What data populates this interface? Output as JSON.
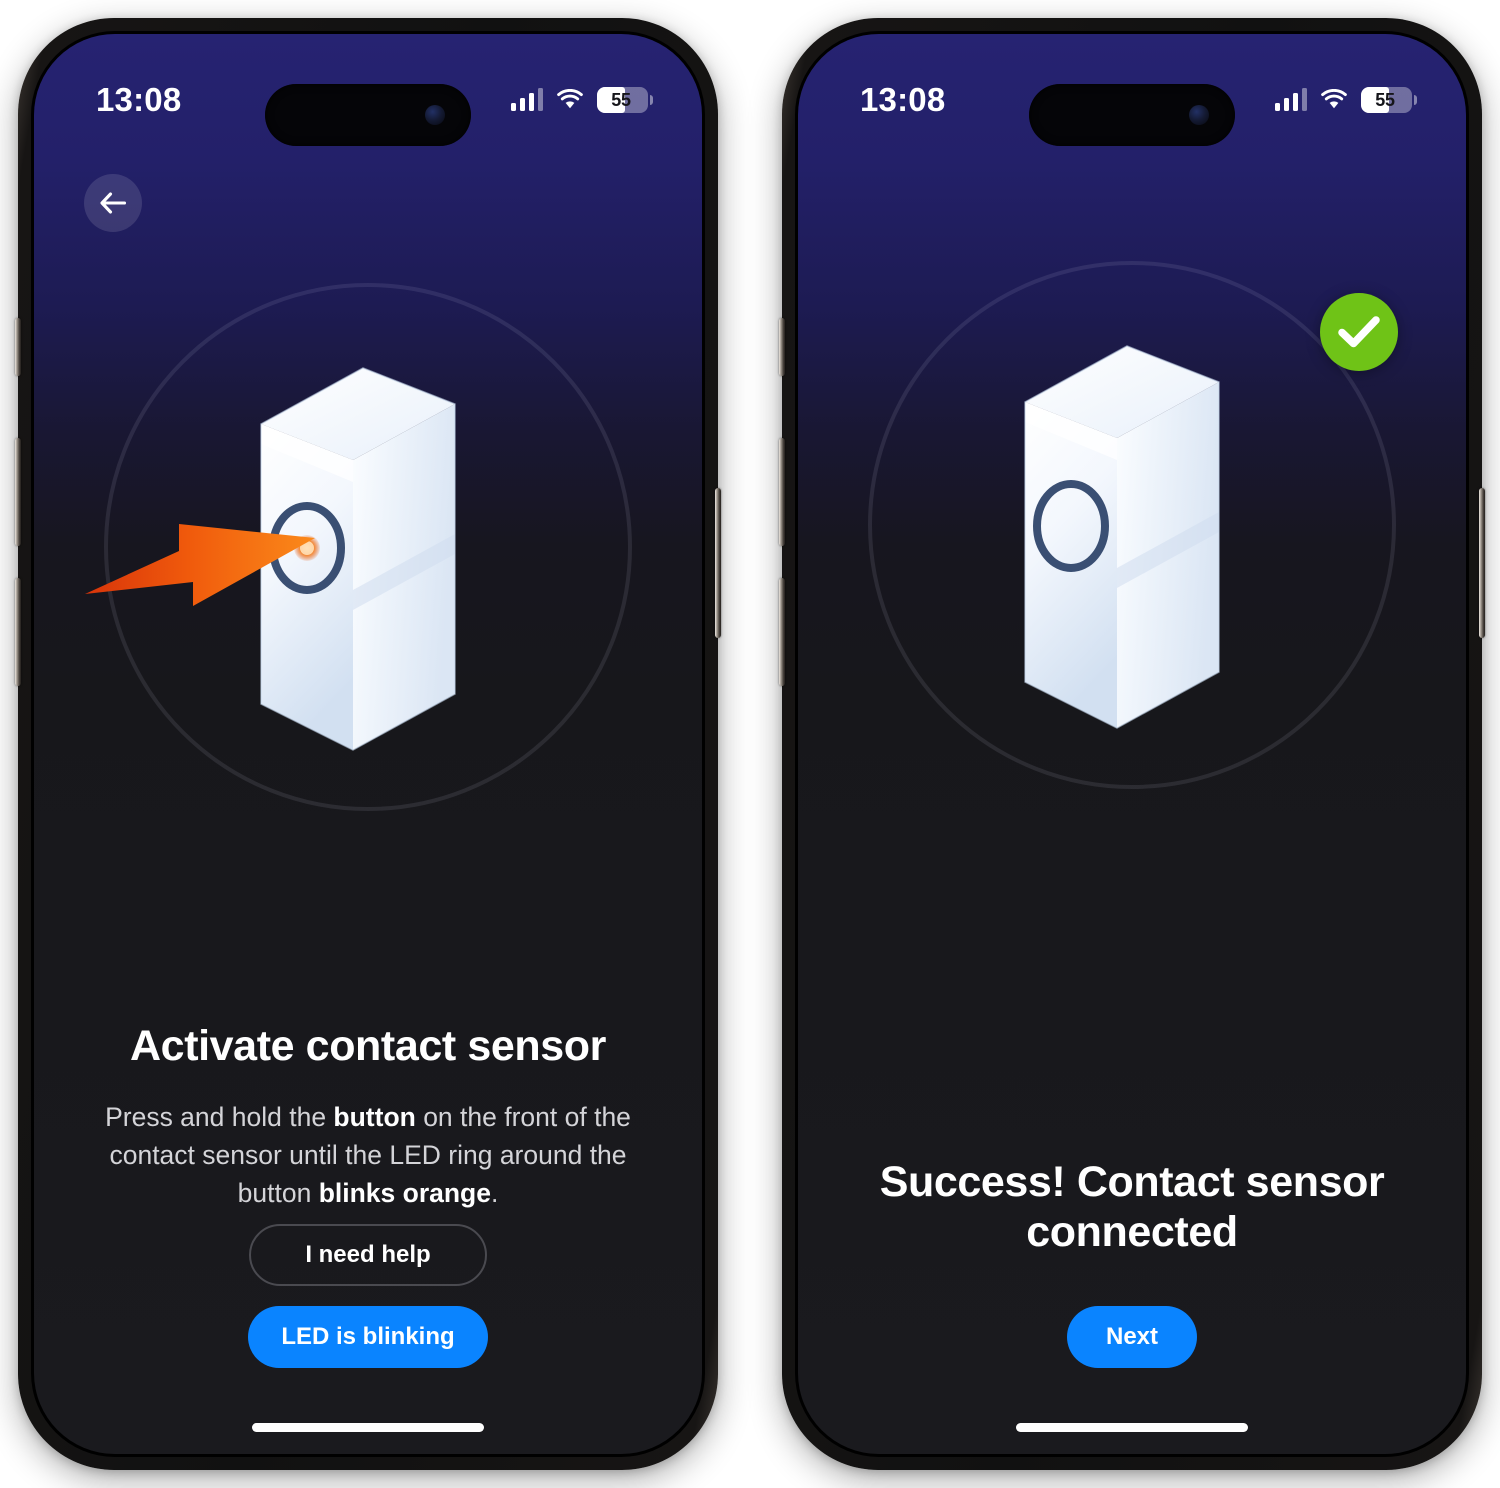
{
  "meta": {
    "app_flow": "Contact sensor pairing",
    "accent_blue": "#0a84ff",
    "success_green": "#6fc317",
    "arrow_orange": "#f26a12"
  },
  "status_bar": {
    "time": "13:08",
    "cellular_icon": "signal-bars-icon",
    "wifi_icon": "wifi-icon",
    "battery_icon": "battery-icon",
    "battery_percent": "55"
  },
  "screens": [
    {
      "id": "activate",
      "back_button_icon": "back-arrow-icon",
      "illustration": {
        "device_name": "contact-sensor-device",
        "ring_decoration": "decorative-circle",
        "pointer_icon": "orange-press-arrow-icon",
        "led_state": "orange"
      },
      "title": "Activate contact sensor",
      "body": {
        "part1": "Press and hold the ",
        "bold1": "button",
        "part2": " on the front of the contact sensor until the LED ring around the button ",
        "bold2": "blinks orange",
        "part3": "."
      },
      "secondary_button": "I need help",
      "primary_button": "LED is blinking"
    },
    {
      "id": "success",
      "illustration": {
        "device_name": "contact-sensor-device",
        "ring_decoration": "decorative-circle",
        "badge_icon": "green-check-badge-icon",
        "led_state": "off"
      },
      "title": "Success! Contact sensor connected",
      "primary_button": "Next"
    }
  ]
}
